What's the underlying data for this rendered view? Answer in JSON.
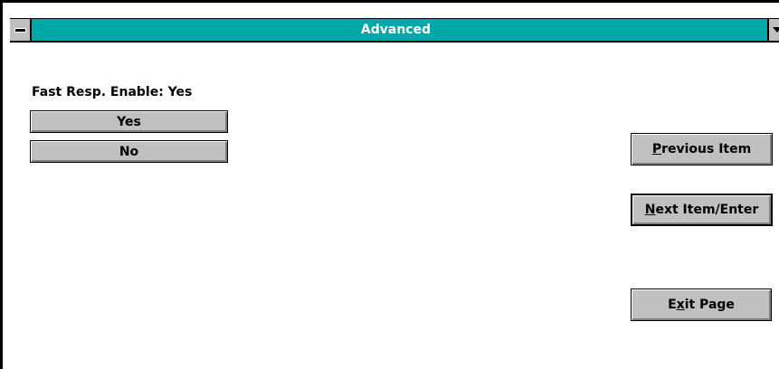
{
  "window": {
    "title": "Advanced"
  },
  "setting": {
    "label": "Fast Resp. Enable: Yes"
  },
  "options": [
    {
      "label": "Yes"
    },
    {
      "label": "No"
    }
  ],
  "nav": {
    "previous": {
      "accel": "P",
      "rest": "revious Item"
    },
    "next": {
      "accel": "N",
      "rest": "ext Item/Enter"
    },
    "exit": {
      "pre": "E",
      "accel": "x",
      "rest": "it Page"
    }
  },
  "colors": {
    "titlebar": "#00a8a8",
    "button_face": "#c0c0c0"
  }
}
